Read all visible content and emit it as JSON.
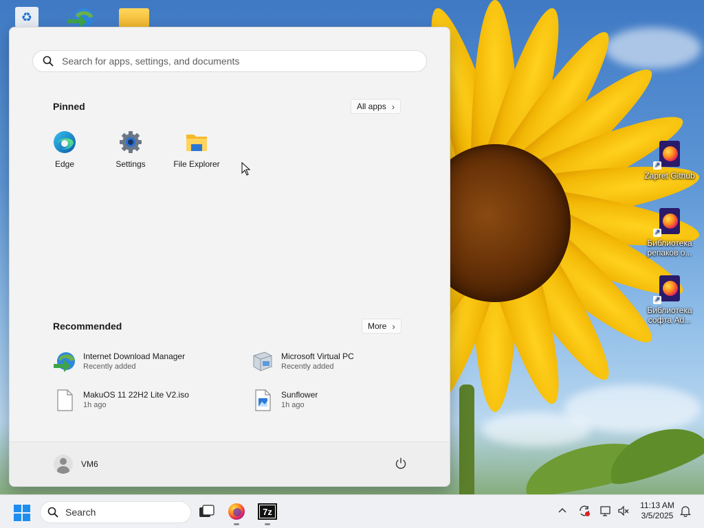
{
  "desktop": {
    "icons": [
      {
        "label": "Zapret Github"
      },
      {
        "label": "Библиотека репаков о..."
      },
      {
        "label": "Библиотека софта Ad..."
      }
    ]
  },
  "start_menu": {
    "search_placeholder": "Search for apps, settings, and documents",
    "pinned_title": "Pinned",
    "all_apps_label": "All apps",
    "pinned": [
      {
        "label": "Edge",
        "icon": "edge-icon"
      },
      {
        "label": "Settings",
        "icon": "gear-icon"
      },
      {
        "label": "File Explorer",
        "icon": "folder-icon"
      }
    ],
    "recommended_title": "Recommended",
    "more_label": "More",
    "recommended": [
      {
        "name": "Internet Download Manager",
        "sub": "Recently added",
        "icon": "idm-icon"
      },
      {
        "name": "Microsoft Virtual PC",
        "sub": "Recently added",
        "icon": "virtual-pc-icon"
      },
      {
        "name": "MakuOS 11 22H2 Lite V2.iso",
        "sub": "1h ago",
        "icon": "file-icon"
      },
      {
        "name": "Sunflower",
        "sub": "1h ago",
        "icon": "image-file-icon"
      }
    ],
    "user_name": "VM6"
  },
  "taskbar": {
    "search_label": "Search",
    "clock_time": "11:13 AM",
    "clock_date": "3/5/2025"
  },
  "colors": {
    "accent": "#1d8ef0",
    "menu_bg": "#f3f3f3",
    "taskbar_bg": "#eef0f4"
  }
}
